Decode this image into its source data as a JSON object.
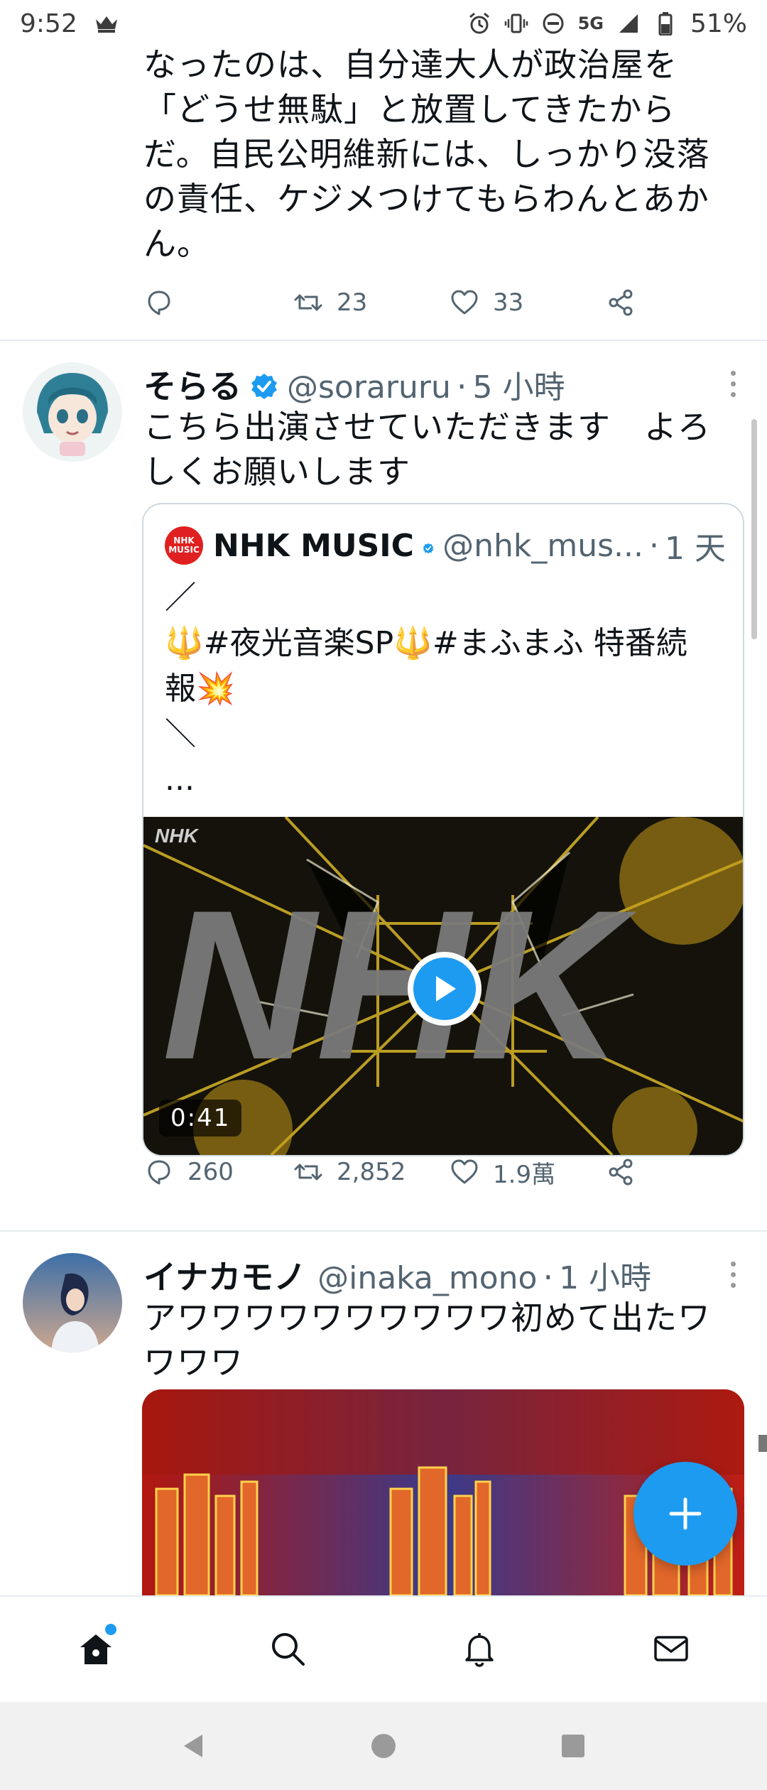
{
  "status_bar": {
    "time": "9:52",
    "network": "5G",
    "battery": "51%"
  },
  "tweets": [
    {
      "text_lines": [
        "なったのは、自分達大人が政治屋を",
        "「どうせ無駄」と放置してきたから",
        "だ。自民公明維新には、しっかり没落",
        "の責任、ケジメつけてもらわんとあか",
        "ん。"
      ],
      "retweets": "23",
      "likes": "33"
    },
    {
      "display_name": "そらる",
      "handle": "@soraruru",
      "time_ago": "5 小時",
      "text_lines": [
        "こちら出演させていただきます　よろ",
        "しくお願いします"
      ],
      "replies": "260",
      "retweets": "2,852",
      "likes": "1.9萬",
      "quote": {
        "display_name": "NHK MUSIC",
        "handle": "@nhk_mus...",
        "time_ago": "1 天",
        "badge_line1": "NHK",
        "badge_line2": "MUSIC",
        "text_lines": [
          "／",
          "🔱#夜光音楽SP🔱#まふまふ 特番続",
          "報💥",
          "＼",
          "..."
        ],
        "video_watermark": "NHK",
        "video_big_logo": "NHK",
        "duration": "0:41"
      }
    },
    {
      "display_name": "イナカモノ",
      "handle": "@inaka_mono",
      "time_ago": "1 小時",
      "text_lines": [
        "アワワワワワワワワワワ初めて出たワ",
        "ワワワ"
      ]
    }
  ],
  "colors": {
    "accent": "#1d9bf0",
    "secondary_text": "#536471",
    "divider": "#e6ecf0"
  }
}
